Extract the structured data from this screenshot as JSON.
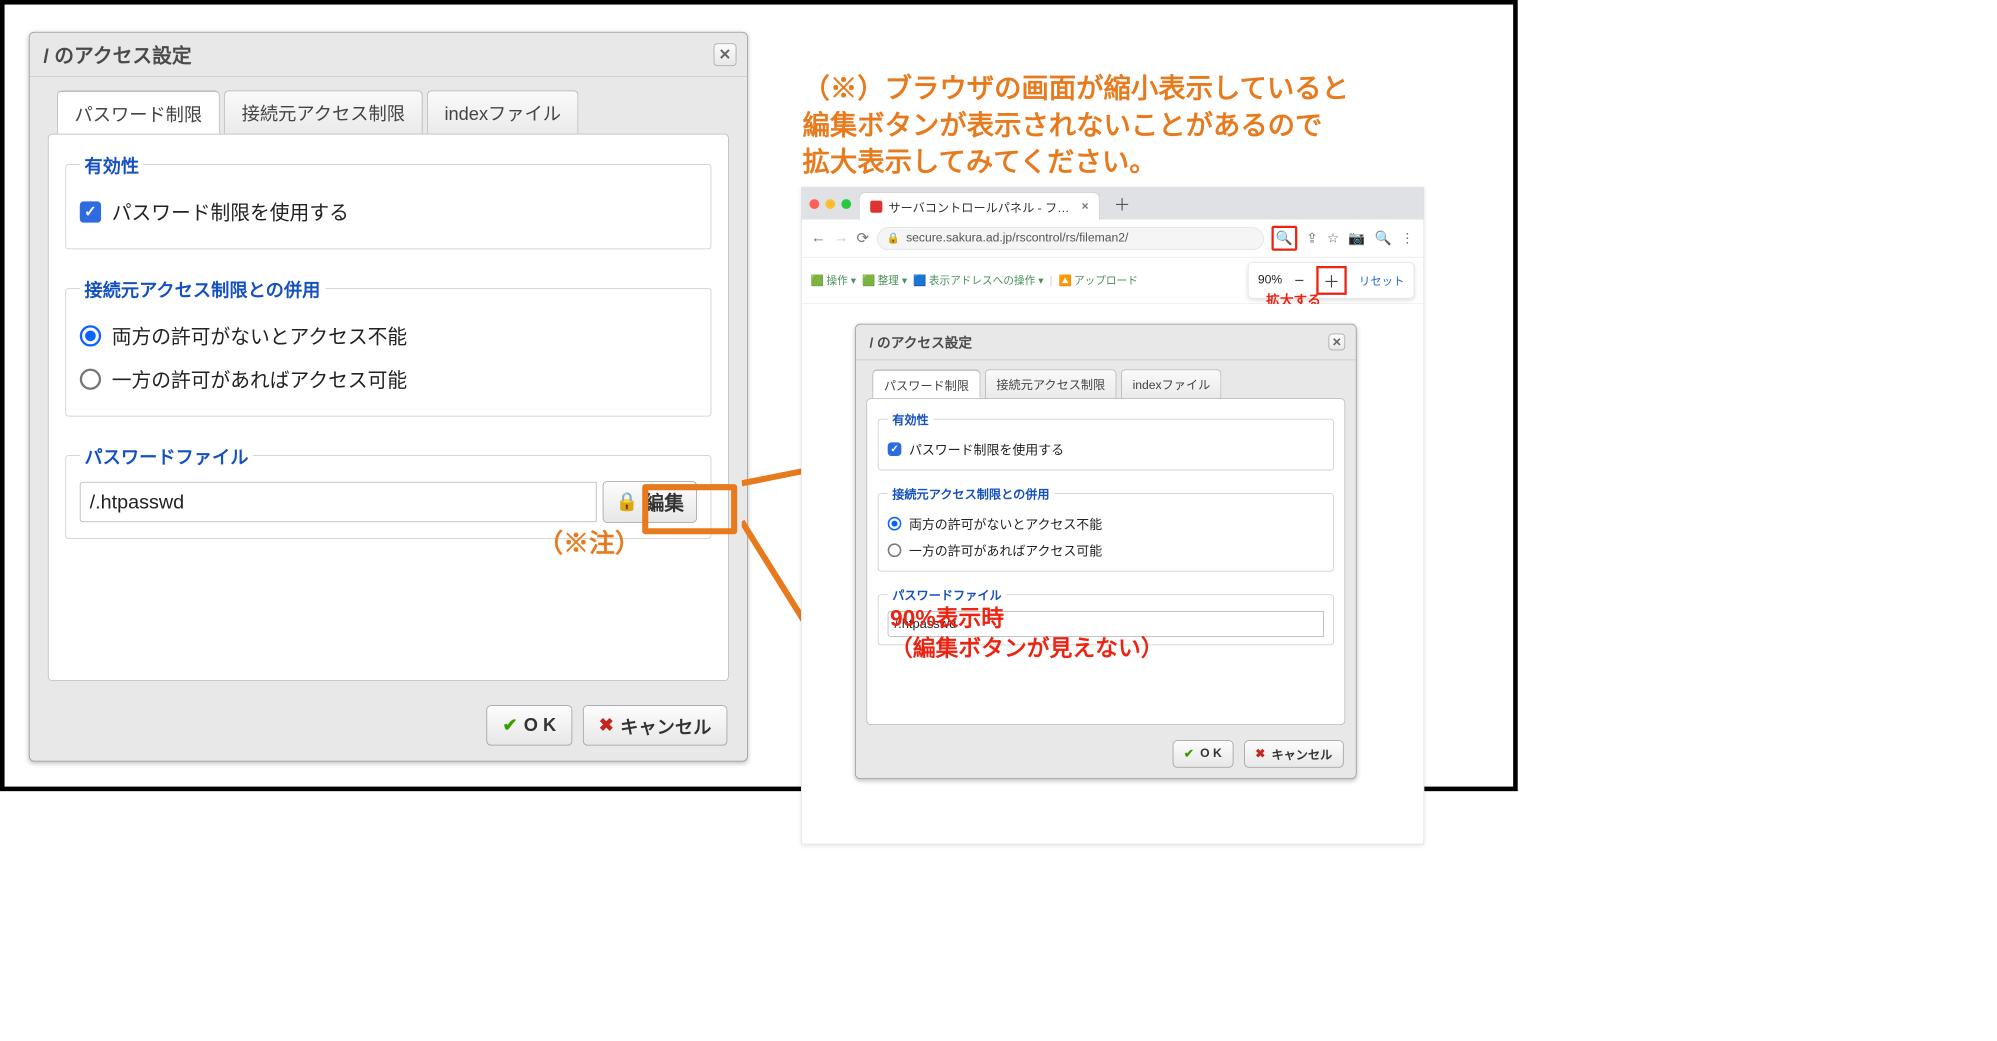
{
  "leftDialog": {
    "title": "/ のアクセス設定",
    "tabs": [
      "パスワード制限",
      "接続元アクセス制限",
      "indexファイル"
    ],
    "group1": {
      "legend": "有効性",
      "checkboxLabel": "パスワード制限を使用する"
    },
    "group2": {
      "legend": "接続元アクセス制限との併用",
      "radio1": "両方の許可がないとアクセス不能",
      "radio2": "一方の許可があればアクセス可能"
    },
    "group3": {
      "legend": "パスワードファイル",
      "filePath": "/.htpasswd",
      "editLabel": "編集"
    },
    "note": "（※注）",
    "okLabel": "O K",
    "cancelLabel": "キャンセル"
  },
  "rightNote": {
    "line1": "（※）ブラウザの画面が縮小表示していると",
    "line2": "編集ボタンが表示されないことがあるので",
    "line3": "拡大表示してみてください。"
  },
  "browser": {
    "tabTitle": "サーバコントロールパネル - フ…",
    "url": "secure.sakura.ad.jp/rscontrol/rs/fileman2/",
    "toolbar": {
      "items": [
        "操作 ▾",
        "整理 ▾",
        "表示アドレスへの操作 ▾",
        "アップロード"
      ]
    },
    "zoom": {
      "value": "90%",
      "reset": "リセット",
      "label": "拡大する"
    }
  },
  "smallDialog": {
    "title": "/ のアクセス設定",
    "tabs": [
      "パスワード制限",
      "接続元アクセス制限",
      "indexファイル"
    ],
    "group1": {
      "legend": "有効性",
      "checkboxLabel": "パスワード制限を使用する"
    },
    "group2": {
      "legend": "接続元アクセス制限との併用",
      "radio1": "両方の許可がないとアクセス不能",
      "radio2": "一方の許可があればアクセス可能"
    },
    "group3": {
      "legend": "パスワードファイル",
      "filePath": "/.htpasswd"
    },
    "okLabel": "O K",
    "cancelLabel": "キャンセル",
    "redNote1": "90%表示時",
    "redNote2": "（編集ボタンが見えない）"
  }
}
